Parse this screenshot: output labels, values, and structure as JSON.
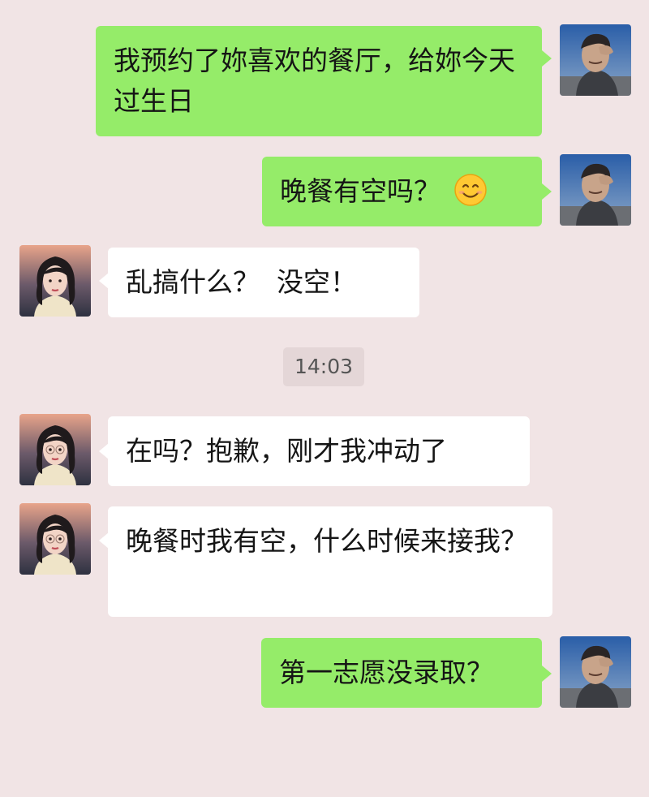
{
  "chat": {
    "messages": [
      {
        "side": "out",
        "text": "我预约了妳喜欢的餐厅，给妳今天过生日"
      },
      {
        "side": "out",
        "text": "晚餐有空吗？",
        "emoji": "smiling-face-icon"
      },
      {
        "side": "in",
        "text": "乱搞什么？  没空！"
      },
      {
        "side": "in",
        "text": "在吗？抱歉，刚才我冲动了"
      },
      {
        "side": "in",
        "text": "晚餐时我有空，什么时候来接我？"
      },
      {
        "side": "out",
        "text": "第一志愿没录取？"
      }
    ],
    "timestamp": "14:03"
  },
  "colors": {
    "background": "#f1e4e5",
    "outgoing_bubble": "#95ec69",
    "incoming_bubble": "#ffffff",
    "timestamp_bg": "#e4d6d7"
  }
}
